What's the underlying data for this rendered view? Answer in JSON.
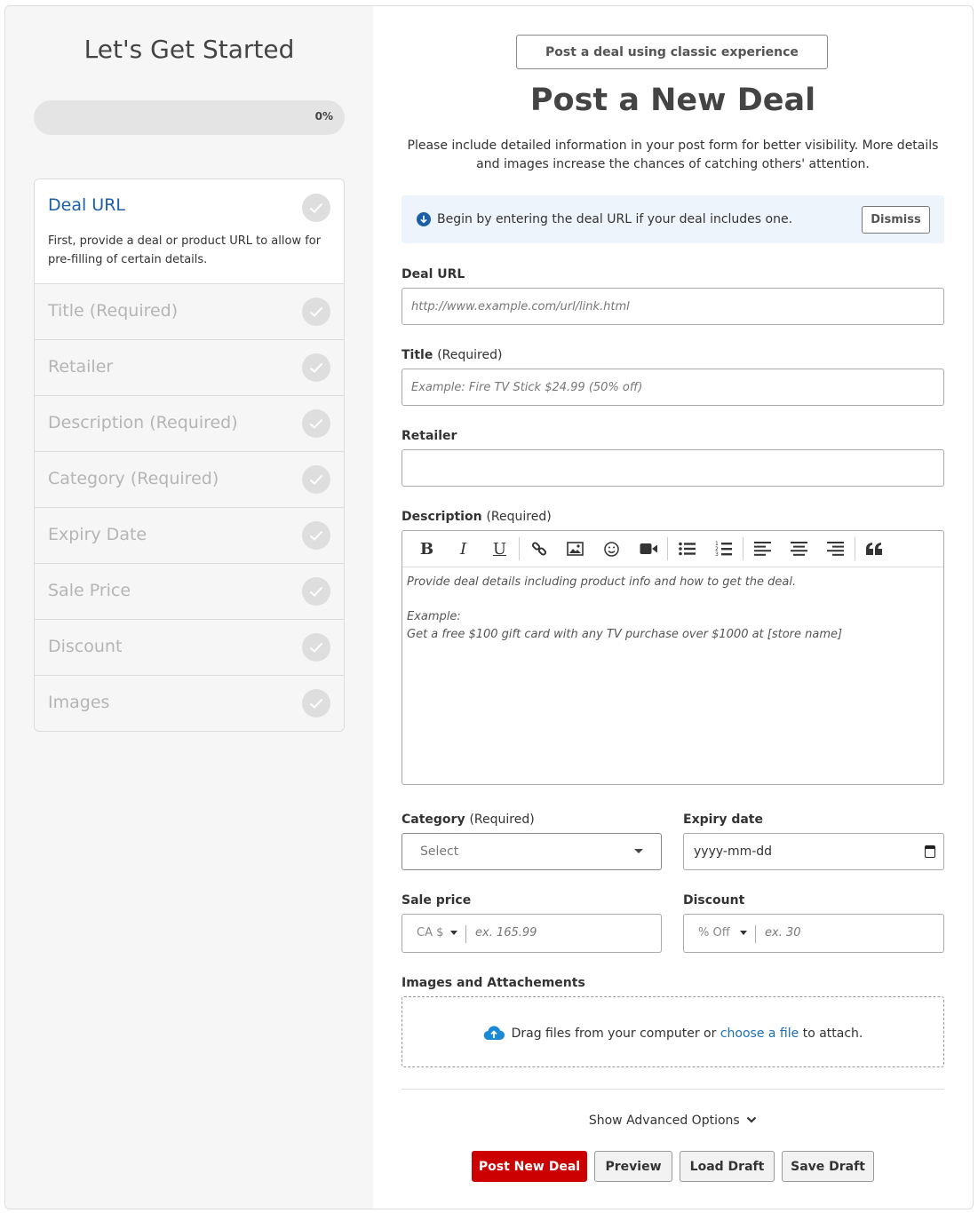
{
  "sidebar": {
    "title": "Let's Get Started",
    "progress": {
      "label": "0%",
      "value": 0
    },
    "steps": [
      {
        "label": "Deal URL",
        "required": "",
        "description": "First, provide a deal or product URL to allow for pre-filling of certain details."
      },
      {
        "label": "Title",
        "required": "(Required)"
      },
      {
        "label": "Retailer",
        "required": ""
      },
      {
        "label": "Description",
        "required": "(Required)"
      },
      {
        "label": "Category",
        "required": "(Required)"
      },
      {
        "label": "Expiry Date",
        "required": ""
      },
      {
        "label": "Sale Price",
        "required": ""
      },
      {
        "label": "Discount",
        "required": ""
      },
      {
        "label": "Images",
        "required": ""
      }
    ]
  },
  "main": {
    "classic_button": "Post a deal using classic experience",
    "title": "Post a New Deal",
    "intro": "Please include detailed information in your post form for better visibility. More details and images increase the chances of catching others' attention.",
    "notice": {
      "text": "Begin by entering the deal URL if your deal includes one.",
      "dismiss": "Dismiss"
    },
    "deal_url": {
      "label": "Deal URL",
      "placeholder": "http://www.example.com/url/link.html"
    },
    "title_field": {
      "label": "Title",
      "required": "(Required)",
      "placeholder": "Example: Fire TV Stick $24.99 (50% off)"
    },
    "retailer": {
      "label": "Retailer",
      "placeholder": ""
    },
    "description": {
      "label": "Description",
      "required": "(Required)",
      "line1": "Provide deal details including product info and how to get the deal.",
      "line2": "Example:",
      "line3": "Get a free $100 gift card with any TV purchase over $1000 at [store name]"
    },
    "category": {
      "label": "Category",
      "required": "(Required)",
      "value": "Select"
    },
    "expiry": {
      "label": "Expiry date",
      "value": "yyyy-mm-dd"
    },
    "sale_price": {
      "label": "Sale price",
      "currency": "CA $",
      "placeholder": "ex. 165.99"
    },
    "discount": {
      "label": "Discount",
      "unit": "% Off",
      "placeholder": "ex. 30"
    },
    "images": {
      "label": "Images and Attachements",
      "text_before": "Drag files from your computer or",
      "link": "choose a file",
      "text_after": "to attach."
    },
    "advanced": "Show Advanced Options",
    "buttons": {
      "post": "Post New Deal",
      "preview": "Preview",
      "load": "Load Draft",
      "save": "Save Draft"
    }
  },
  "colors": {
    "accent_blue": "#1a5fa8",
    "primary_red": "#cc0000",
    "notice_bg": "#eef4fb"
  },
  "icons": [
    "check-icon",
    "info-arrow-down-icon",
    "bold-icon",
    "italic-icon",
    "underline-icon",
    "link-icon",
    "image-icon",
    "emoji-icon",
    "video-icon",
    "bullet-list-icon",
    "numbered-list-icon",
    "align-left-icon",
    "align-center-icon",
    "align-right-icon",
    "quote-icon",
    "calendar-icon",
    "cloud-upload-icon",
    "chevron-down-icon"
  ]
}
